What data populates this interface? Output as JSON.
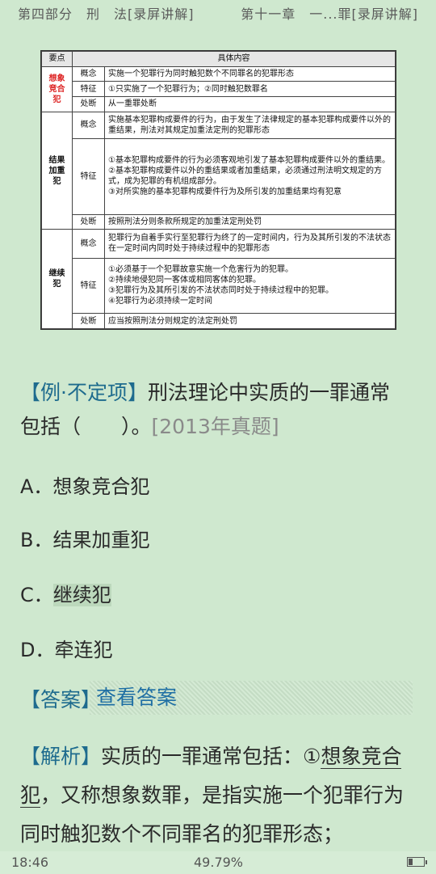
{
  "header": {
    "left": "第四部分　刑　法[录屏讲解]",
    "right": "第十一章　一...罪[录屏讲解]"
  },
  "table": {
    "col_headers": [
      "要点",
      "具体内容"
    ],
    "groups": [
      {
        "name": "想象竞合犯",
        "rows": [
          {
            "sub": "概念",
            "text": "实施一个犯罪行为同时触犯数个不同罪名的犯罪形态"
          },
          {
            "sub": "特征",
            "text": "①只实施了一个犯罪行为；②同时触犯数罪名"
          },
          {
            "sub": "处断",
            "text": "从一重罪处断"
          }
        ]
      },
      {
        "name": "结果加重犯",
        "rows": [
          {
            "sub": "概念",
            "text": "实施基本犯罪构成要件的行为，由于发生了法律规定的基本犯罪构成要件以外的重结果，刑法对其规定加重法定刑的犯罪形态"
          },
          {
            "sub": "特征",
            "lines": [
              "①基本犯罪构成要件的行为必须客观地引发了基本犯罪构成要件以外的重结果。",
              "②基本犯罪构成要件以外的重结果或者加重结果，必须通过刑法明文规定的方式，成为犯罪的有机组成部分。",
              "③对所实施的基本犯罪构成要件行为及所引发的加重结果均有犯意"
            ]
          },
          {
            "sub": "处断",
            "text": "按照刑法分则条款所规定的加重法定刑处罚"
          }
        ]
      },
      {
        "name": "继续犯",
        "rows": [
          {
            "sub": "概念",
            "text": "犯罪行为自着手实行至犯罪行为终了的一定时间内，行为及其所引发的不法状态在一定时间内同时处于持续过程中的犯罪形态"
          },
          {
            "sub": "特征",
            "lines": [
              "①必须基于一个犯罪故意实施一个危害行为的犯罪。",
              "②持续地侵犯同一客体或相同客体的犯罪。",
              "③犯罪行为及其所引发的不法状态同时处于持续过程中的犯罪。",
              "④犯罪行为必须持续一定时间"
            ]
          },
          {
            "sub": "处断",
            "text": "应当按照刑法分则规定的法定刑处罚"
          }
        ]
      }
    ]
  },
  "question": {
    "tag": "【例·不定项】",
    "text_line1": "刑法理论中实质的一罪通常",
    "text_line2": "包括（　　）。",
    "year": "[2013年真题]"
  },
  "options": [
    {
      "label": "A．想象竞合犯"
    },
    {
      "label": "B．结果加重犯"
    },
    {
      "label_prefix": "C．",
      "label": "继续犯"
    },
    {
      "label": "D．牵连犯"
    }
  ],
  "answer": {
    "tag": "【答案】",
    "link": "查看答案"
  },
  "analysis": {
    "tag": "【解析】",
    "p1": "实质的一罪通常包括：①",
    "u1": "想象竞合犯",
    "p2": "，又称想象数罪，是指实施一个犯罪行为同时触犯数个不同罪名的犯罪形态；"
  },
  "status": {
    "time": "18:46",
    "progress": "49.79%",
    "battery_level": 0.3
  }
}
